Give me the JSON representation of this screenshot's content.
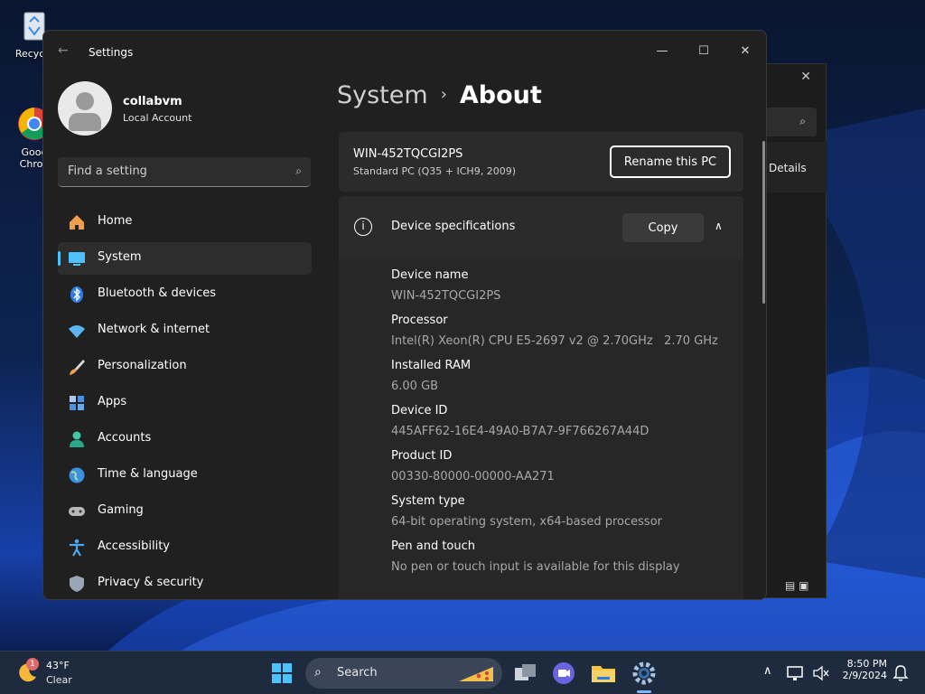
{
  "desktop": {
    "icons": [
      {
        "label": "Recycle"
      },
      {
        "label": "Goog\nChron"
      }
    ]
  },
  "bg_window": {
    "details_label": "Details"
  },
  "window": {
    "title": "Settings",
    "controls": {
      "minimize": "—",
      "maximize": "☐",
      "close": "✕"
    }
  },
  "profile": {
    "name": "collabvm",
    "account_type": "Local Account"
  },
  "search": {
    "placeholder": "Find a setting"
  },
  "nav": {
    "items": [
      {
        "label": "Home",
        "icon": "home-icon"
      },
      {
        "label": "System",
        "icon": "system-icon",
        "active": true
      },
      {
        "label": "Bluetooth & devices",
        "icon": "bluetooth-icon"
      },
      {
        "label": "Network & internet",
        "icon": "wifi-icon"
      },
      {
        "label": "Personalization",
        "icon": "brush-icon"
      },
      {
        "label": "Apps",
        "icon": "apps-icon"
      },
      {
        "label": "Accounts",
        "icon": "accounts-icon"
      },
      {
        "label": "Time & language",
        "icon": "globe-icon"
      },
      {
        "label": "Gaming",
        "icon": "gamepad-icon"
      },
      {
        "label": "Accessibility",
        "icon": "accessibility-icon"
      },
      {
        "label": "Privacy & security",
        "icon": "shield-icon"
      }
    ]
  },
  "breadcrumb": {
    "parent": "System",
    "separator": "›",
    "current": "About"
  },
  "pc": {
    "name": "WIN-452TQCGI2PS",
    "model": "Standard PC (Q35 + ICH9, 2009)",
    "rename_label": "Rename this PC"
  },
  "device_specs": {
    "title": "Device specifications",
    "copy_label": "Copy",
    "fields": [
      {
        "label": "Device name",
        "value": "WIN-452TQCGI2PS"
      },
      {
        "label": "Processor",
        "value": "Intel(R) Xeon(R) CPU E5-2697 v2 @ 2.70GHz   2.70 GHz"
      },
      {
        "label": "Installed RAM",
        "value": "6.00 GB"
      },
      {
        "label": "Device ID",
        "value": "445AFF62-16E4-49A0-B7A7-9F766267A44D"
      },
      {
        "label": "Product ID",
        "value": "00330-80000-00000-AA271"
      },
      {
        "label": "System type",
        "value": "64-bit operating system, x64-based processor"
      },
      {
        "label": "Pen and touch",
        "value": "No pen or touch input is available for this display"
      }
    ]
  },
  "taskbar": {
    "weather": {
      "badge": "1",
      "temp": "43°F",
      "condition": "Clear"
    },
    "search_label": "Search",
    "clock": {
      "time": "8:50 PM",
      "date": "2/9/2024"
    }
  },
  "colors": {
    "accent": "#4cc2ff",
    "window_bg": "#202020",
    "card_bg": "#2b2b2b"
  }
}
